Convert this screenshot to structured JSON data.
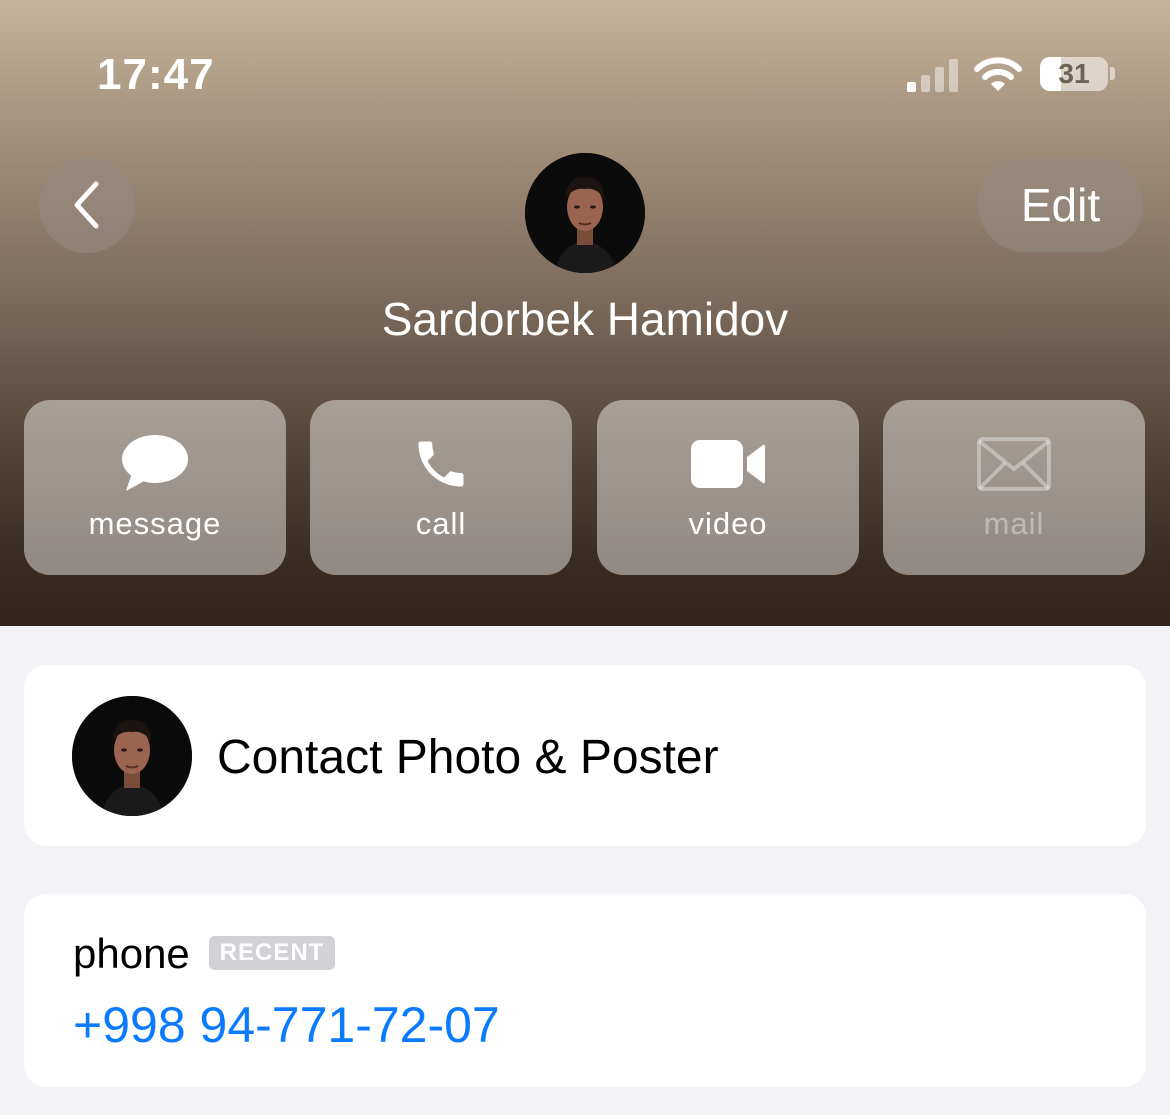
{
  "status_bar": {
    "time": "17:47",
    "battery": "31",
    "battery_level": 0.31
  },
  "nav": {
    "back_icon": "chevron-left-icon",
    "edit_label": "Edit"
  },
  "contact": {
    "name": "Sardorbek Hamidov",
    "avatar": "person-photo"
  },
  "actions": [
    {
      "label": "message",
      "icon": "message-bubble-icon",
      "enabled": true
    },
    {
      "label": "call",
      "icon": "phone-icon",
      "enabled": true
    },
    {
      "label": "video",
      "icon": "video-camera-icon",
      "enabled": true
    },
    {
      "label": "mail",
      "icon": "envelope-icon",
      "enabled": false
    }
  ],
  "photo_card": {
    "label": "Contact Photo & Poster"
  },
  "phone_card": {
    "label": "phone",
    "badge": "RECENT",
    "number": "+998 94-771-72-07"
  },
  "colors": {
    "link": "#0a7aff",
    "background": "#f2f2f7",
    "card": "#ffffff"
  }
}
